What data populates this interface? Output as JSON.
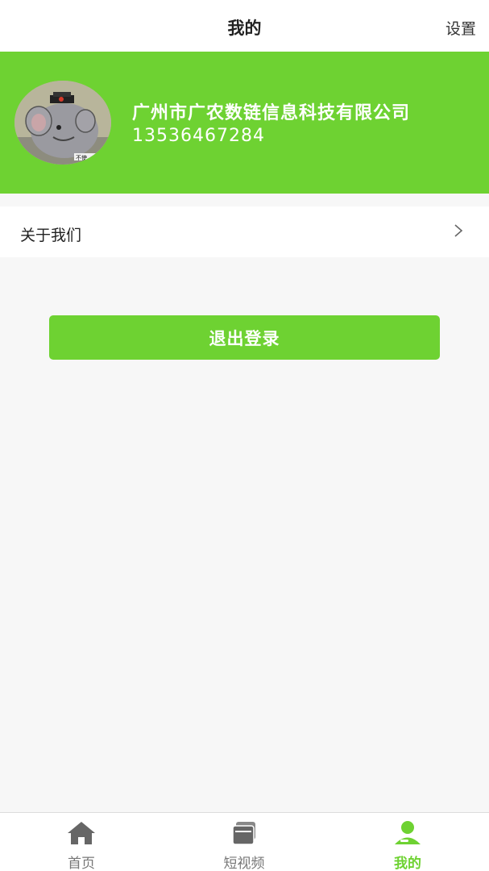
{
  "header": {
    "title": "我的",
    "settings_label": "设置"
  },
  "profile": {
    "company": "广州市广农数链信息科技有限公司",
    "phone": "13536467284"
  },
  "menu": {
    "about_label": "关于我们"
  },
  "logout": {
    "label": "退出登录"
  },
  "tabbar": {
    "items": [
      {
        "label": "首页",
        "icon": "home-icon"
      },
      {
        "label": "短视频",
        "icon": "video-icon"
      },
      {
        "label": "我的",
        "icon": "user-icon"
      }
    ],
    "active_index": 2
  },
  "colors": {
    "accent": "#6ed232",
    "background": "#f7f7f7",
    "tab_inactive": "#777777"
  }
}
